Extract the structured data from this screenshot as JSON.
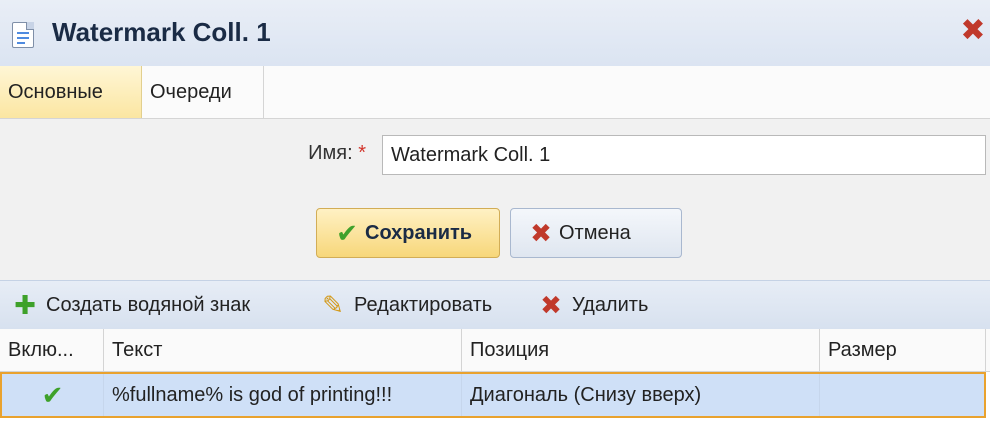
{
  "window": {
    "title": "Watermark Coll. 1",
    "close_icon": "✖"
  },
  "tabs": [
    {
      "label": "Основные",
      "active": true
    },
    {
      "label": "Очереди",
      "active": false
    }
  ],
  "form": {
    "name_label": "Имя:",
    "required_mark": "*",
    "name_value": "Watermark Coll. 1"
  },
  "buttons": {
    "save_label": "Сохранить",
    "cancel_label": "Отмена"
  },
  "toolbar": {
    "create_label": "Создать водяной знак",
    "edit_label": "Редактировать",
    "delete_label": "Удалить"
  },
  "grid": {
    "columns": [
      "Вклю...",
      "Текст",
      "Позиция",
      "Размер"
    ],
    "rows": [
      {
        "enabled": true,
        "text": "%fullname% is god of printing!!!",
        "position": "Диагональ (Снизу вверх)",
        "size": ""
      }
    ]
  },
  "colors": {
    "accent": "#f7d77a",
    "selection": "#cfe0f7",
    "selection_border": "#e9a22e",
    "danger": "#c0392b",
    "success": "#41a12c"
  }
}
